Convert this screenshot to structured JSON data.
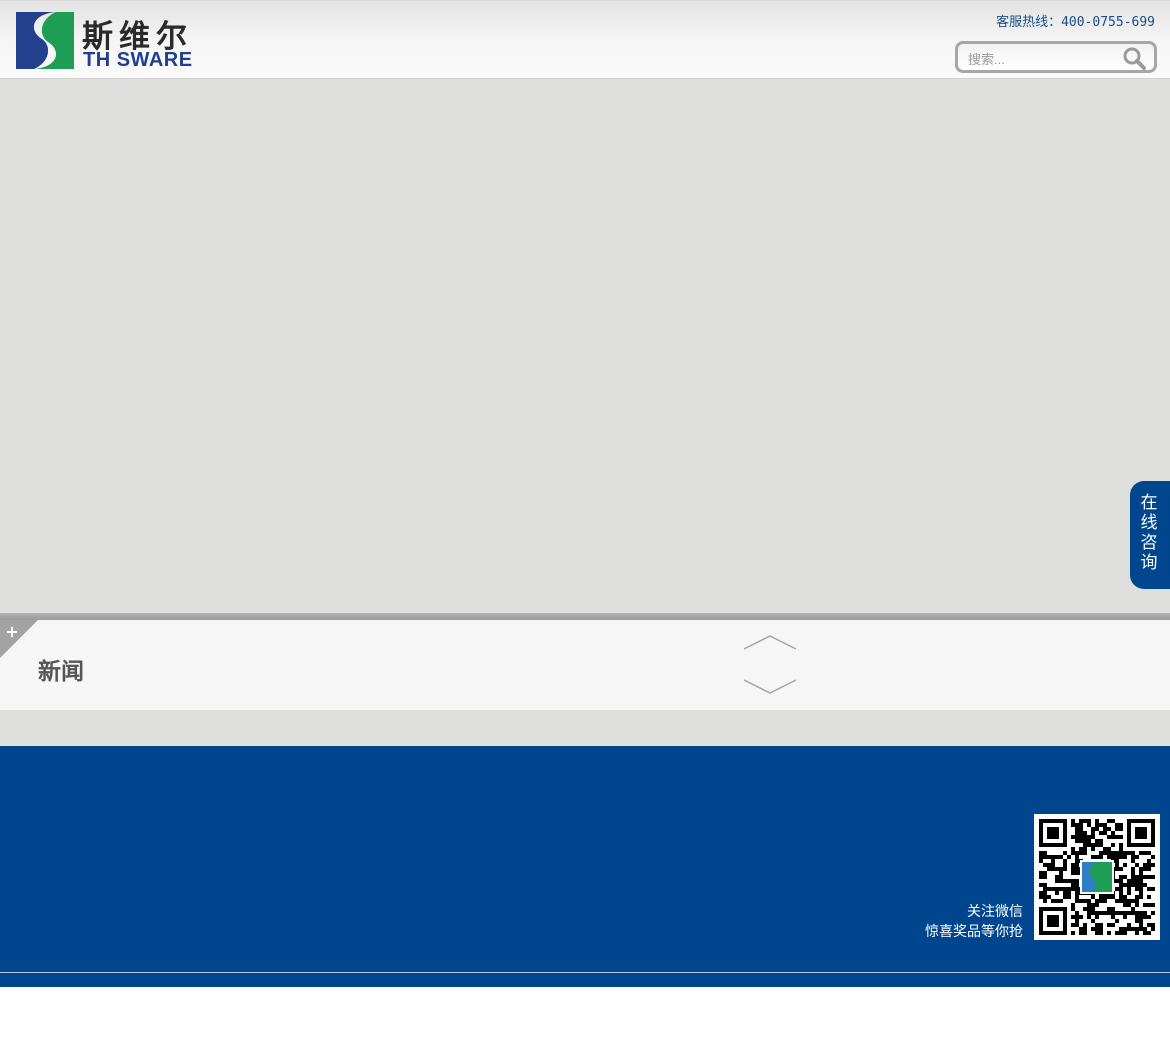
{
  "header": {
    "brand_cn": "斯维尔",
    "brand_en": "TH SWARE",
    "hotline": "客服热线：400-0755-699",
    "search_placeholder": "搜索..."
  },
  "consult": {
    "label": "在线咨询"
  },
  "news": {
    "title": "新闻",
    "corner_symbol": "+"
  },
  "footer": {
    "wechat_line1": "关注微信",
    "wechat_line2": "惊喜奖品等你抢"
  },
  "colors": {
    "brand_blue": "#00468f",
    "logo_green": "#1e9e55",
    "banner_gray": "#dededc"
  },
  "icons": [
    "search-icon",
    "plus-icon",
    "chevron-up-icon",
    "chevron-down-icon",
    "qr-code-icon"
  ]
}
